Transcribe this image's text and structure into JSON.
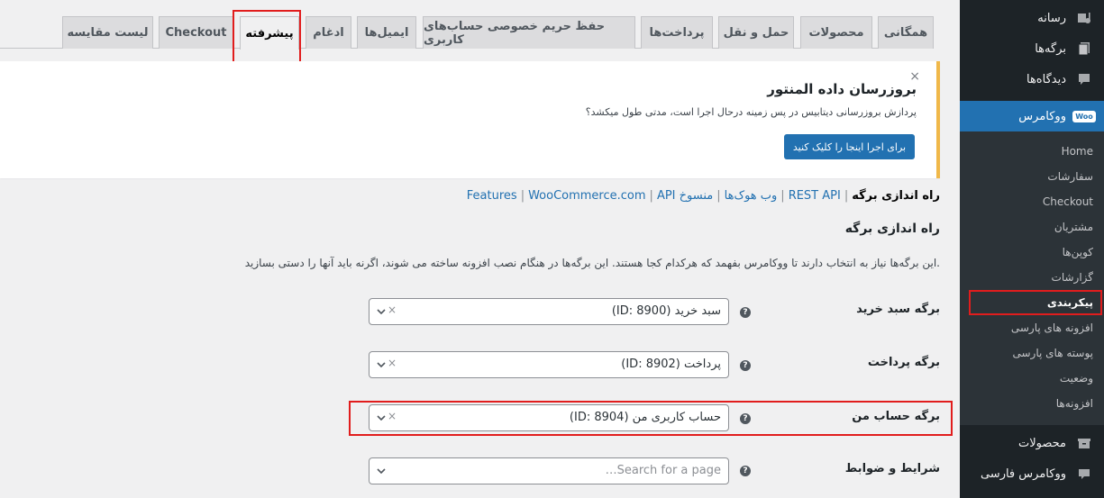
{
  "sidebar": {
    "top_items": [
      {
        "label": "رسانه",
        "icon": "media-icon"
      },
      {
        "label": "برگه‌ها",
        "icon": "pages-icon"
      },
      {
        "label": "دیدگاه‌ها",
        "icon": "comments-icon"
      }
    ],
    "woocommerce": {
      "label": "ووکامرس",
      "badge": "Woo"
    },
    "submenu": [
      "Home",
      "سفارشات",
      "Checkout",
      "مشتریان",
      "کوپن‌ها",
      "گزارشات",
      "پیکربندی",
      "افزونه های پارسی",
      "پوسته های پارسی",
      "وضعیت",
      "افزونه‌ها"
    ],
    "current_submenu": "پیکربندی",
    "bottom_items": [
      {
        "label": "محصولات",
        "icon": "products-icon"
      },
      {
        "label": "ووکامرس فارسی",
        "icon": "woo-persian-icon"
      }
    ]
  },
  "tabs": [
    "همگانی",
    "محصولات",
    "حمل و نقل",
    "پرداخت‌ها",
    "حفظ حریم خصوصی حساب‌های کاربری",
    "ایمیل‌ها",
    "ادغام",
    "پیشرفته",
    "Checkout",
    "لیست مقایسه"
  ],
  "active_tab": "پیشرفته",
  "notice": {
    "title": "بروزرسان داده المنتور",
    "text": "پردازش بروزرسانی دیتابیس در پس زمینه درحال اجرا است، مدتی طول میکشد؟",
    "button": "برای اجرا اینجا را کلیک کنید",
    "dismiss": "×"
  },
  "sublinks": {
    "current": "راه اندازی برگه",
    "links": [
      "REST API",
      "وب هوک‌ها",
      "API منسوخ",
      "WooCommerce.com",
      "Features"
    ],
    "separator": "|"
  },
  "section": {
    "title": "راه اندازی برگه",
    "description": "این برگه‌ها نیاز به انتخاب دارند تا ووکامرس بفهمد که هرکدام کجا هستند. این برگه‌ها در هنگام نصب افزونه ساخته می شوند، اگرنه باید آنها را دستی بسازید."
  },
  "fields": [
    {
      "label": "برگه سبد خرید",
      "value": "سبد خرید (ID: 8900)",
      "clear": "×"
    },
    {
      "label": "برگه پرداخت",
      "value": "پرداخت (ID: 8902)",
      "clear": "×"
    },
    {
      "label": "برگه حساب من",
      "value": "حساب کاربری من (ID: 8904)",
      "clear": "×"
    },
    {
      "label": "شرایط و ضوابط",
      "placeholder": "Search for a page…"
    }
  ],
  "help_glyph": "?",
  "colors": {
    "accent": "#2271b1",
    "sidebar_bg": "#1d2327",
    "highlight": "#e11d1d",
    "notice_border": "#f0b849"
  }
}
